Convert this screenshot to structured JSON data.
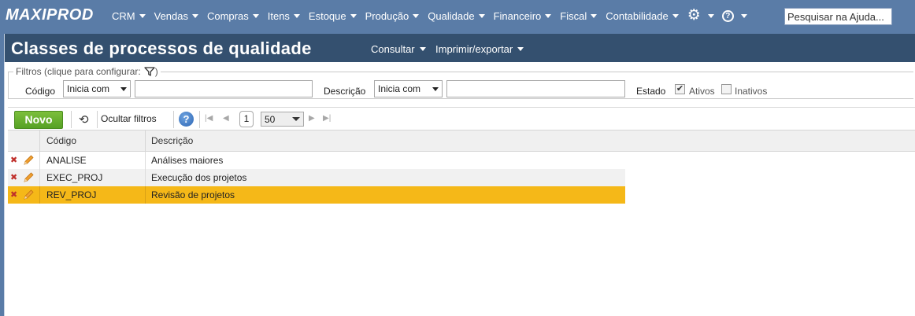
{
  "app": {
    "logo": "MAXIPROD"
  },
  "menu": {
    "items": [
      "CRM",
      "Vendas",
      "Compras",
      "Itens",
      "Estoque",
      "Produção",
      "Qualidade",
      "Financeiro",
      "Fiscal",
      "Contabilidade"
    ],
    "icons": [
      "gear-icon",
      "help-icon"
    ]
  },
  "search": {
    "placeholder": "Pesquisar na Ajuda..."
  },
  "page": {
    "title": "Classes de processos de qualidade",
    "menu_consultar": "Consultar",
    "menu_imprimir": "Imprimir/exportar"
  },
  "filters": {
    "legend": "Filtros (clique para configurar:",
    "legend_close": ")",
    "codigo_label": "Código",
    "codigo_mode": "Inicia com",
    "codigo_value": "",
    "descricao_label": "Descrição",
    "descricao_mode": "Inicia com",
    "descricao_value": "",
    "estado_label": "Estado",
    "ativos_label": "Ativos",
    "ativos_checked": true,
    "inativos_label": "Inativos",
    "inativos_checked": false
  },
  "toolbar": {
    "new_label": "Novo",
    "hide_filters_label": "Ocultar filtros",
    "help": "?",
    "page": "1",
    "page_size": "50"
  },
  "grid": {
    "columns": [
      "Código",
      "Descrição"
    ],
    "rows": [
      {
        "codigo": "ANALISE",
        "descricao": "Análises maiores",
        "selected": false
      },
      {
        "codigo": "EXEC_PROJ",
        "descricao": "Execução dos projetos",
        "selected": false
      },
      {
        "codigo": "REV_PROJ",
        "descricao": "Revisão de projetos",
        "selected": true
      }
    ]
  },
  "colors": {
    "topbar": "#5a7ca7",
    "titlebar": "#34506f",
    "new_button": "#5fa82b",
    "selected_row": "#f5b818"
  }
}
